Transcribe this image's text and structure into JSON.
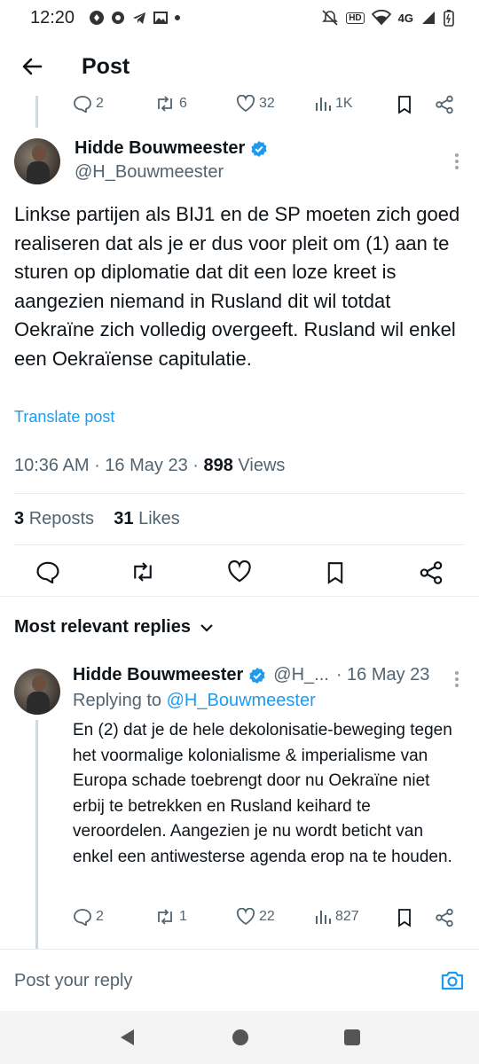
{
  "status_bar": {
    "time": "12:20",
    "hd": "HD",
    "network": "4G"
  },
  "header": {
    "title": "Post"
  },
  "prev_post_actions": {
    "replies": "2",
    "reposts": "6",
    "likes": "32",
    "views": "1K"
  },
  "post": {
    "author_name": "Hidde Bouwmeester",
    "author_handle": "@H_Bouwmeester",
    "text": "Linkse partijen als BIJ1 en de SP moeten zich goed realiseren dat als je er dus voor pleit om (1) aan te sturen op diplomatie dat dit een loze kreet is aangezien niemand in Rusland dit wil totdat Oekraïne zich volledig overgeeft. Rusland wil enkel een Oekraïense capitulatie.",
    "translate_label": "Translate post",
    "time": "10:36 AM",
    "date": "16 May 23",
    "views_count": "898",
    "views_label": "Views",
    "reposts_count": "3",
    "reposts_label": "Reposts",
    "likes_count": "31",
    "likes_label": "Likes"
  },
  "replies_section": {
    "label": "Most relevant replies"
  },
  "reply": {
    "author_name": "Hidde Bouwmeester",
    "author_handle": "@H_...",
    "date": "· 16 May 23",
    "replying_prefix": "Replying to",
    "replying_to": "@H_Bouwmeester",
    "text": "En (2) dat je de hele dekolonisatie-beweging tegen het voormalige kolonialisme & imperialisme van Europa schade toebrengt door nu Oekraïne niet erbij te betrekken en Rusland keihard te veroordelen. Aangezien je nu wordt beticht van enkel een antiwesterse agenda erop na te houden.",
    "replies": "2",
    "reposts": "1",
    "likes": "22",
    "views": "827"
  },
  "compose": {
    "placeholder": "Post your reply"
  },
  "colors": {
    "accent": "#1d9bf0",
    "text": "#0f1419",
    "muted": "#536471"
  }
}
